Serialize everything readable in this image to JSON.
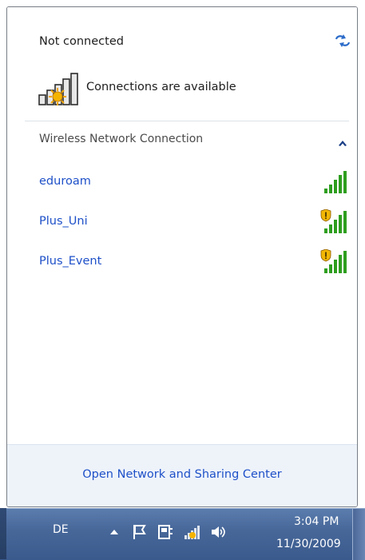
{
  "status": {
    "title": "Not connected",
    "subtitle": "Connections are available",
    "refresh_icon": "refresh-arrows-icon",
    "connection_icon": "signal-bars-with-sun-icon"
  },
  "section": {
    "title": "Wireless Network Connection",
    "collapse_icon": "chevron-up-icon"
  },
  "networks": [
    {
      "name": "eduroam",
      "secured_warning": false,
      "signal_bars": 5,
      "signal_color": "#2e9e1e"
    },
    {
      "name": "Plus_Uni",
      "secured_warning": true,
      "signal_bars": 5,
      "signal_color": "#2e9e1e"
    },
    {
      "name": "Plus_Event",
      "secured_warning": true,
      "signal_bars": 5,
      "signal_color": "#2e9e1e"
    }
  ],
  "footer": {
    "link": "Open Network and Sharing Center"
  },
  "taskbar": {
    "language": "DE",
    "tray_icons": [
      "show-hidden-icons-arrow-icon",
      "action-center-flag-icon",
      "power-plug-icon",
      "network-status-icon",
      "volume-icon"
    ],
    "time": "3:04 PM",
    "date": "11/30/2009"
  },
  "colors": {
    "link": "#1e50c8",
    "footer_bg": "#eef3fa",
    "taskbar_bg": "#48689a"
  }
}
